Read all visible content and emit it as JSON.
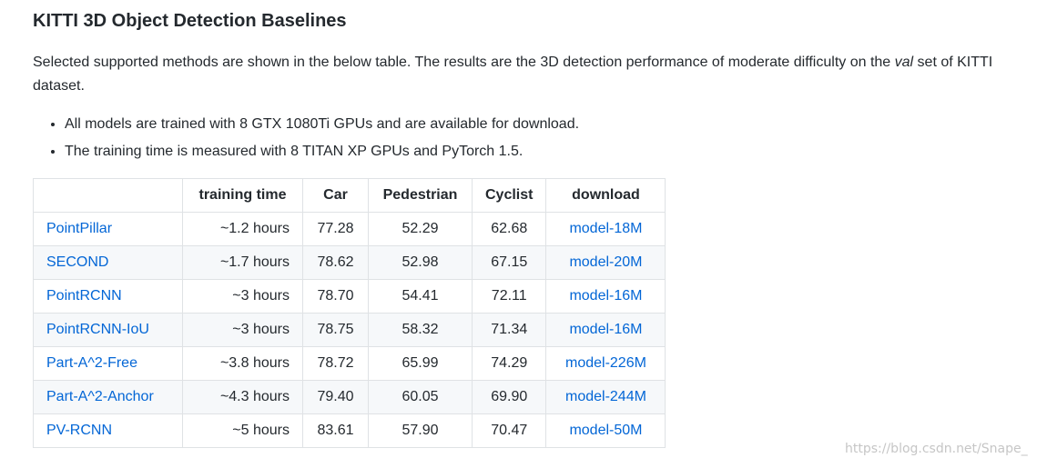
{
  "heading": "KITTI 3D Object Detection Baselines",
  "intro": {
    "before": "Selected supported methods are shown in the below table. The results are the 3D detection performance of moderate difficulty on the ",
    "em": "val",
    "after": " set of KITTI dataset."
  },
  "bullets": [
    "All models are trained with 8 GTX 1080Ti GPUs and are available for download.",
    "The training time is measured with 8 TITAN XP GPUs and PyTorch 1.5."
  ],
  "table": {
    "headers": [
      "",
      "training time",
      "Car",
      "Pedestrian",
      "Cyclist",
      "download"
    ],
    "rows": [
      {
        "method": "PointPillar",
        "time": "~1.2 hours",
        "car": "77.28",
        "ped": "52.29",
        "cyc": "62.68",
        "download": "model-18M"
      },
      {
        "method": "SECOND",
        "time": "~1.7 hours",
        "car": "78.62",
        "ped": "52.98",
        "cyc": "67.15",
        "download": "model-20M"
      },
      {
        "method": "PointRCNN",
        "time": "~3 hours",
        "car": "78.70",
        "ped": "54.41",
        "cyc": "72.11",
        "download": "model-16M"
      },
      {
        "method": "PointRCNN-IoU",
        "time": "~3 hours",
        "car": "78.75",
        "ped": "58.32",
        "cyc": "71.34",
        "download": "model-16M"
      },
      {
        "method": "Part-A^2-Free",
        "time": "~3.8 hours",
        "car": "78.72",
        "ped": "65.99",
        "cyc": "74.29",
        "download": "model-226M"
      },
      {
        "method": "Part-A^2-Anchor",
        "time": "~4.3 hours",
        "car": "79.40",
        "ped": "60.05",
        "cyc": "69.90",
        "download": "model-244M"
      },
      {
        "method": "PV-RCNN",
        "time": "~5 hours",
        "car": "83.61",
        "ped": "57.90",
        "cyc": "70.47",
        "download": "model-50M"
      }
    ]
  },
  "watermark": "https://blog.csdn.net/Snape_",
  "colors": {
    "text": "#24292e",
    "link": "#0366d6",
    "border": "#dfe2e5",
    "stripe": "#f6f8fa"
  }
}
